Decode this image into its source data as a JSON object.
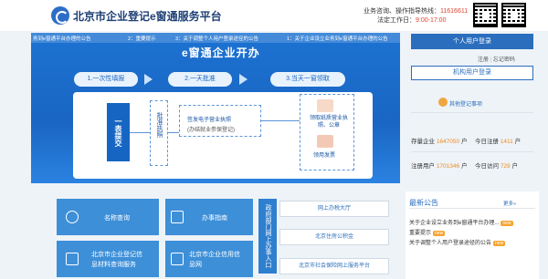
{
  "header": {
    "title": "北京市企业登记e窗通服务平台",
    "hotline_label": "业务咨询、操作指导热线：",
    "hotline_number": "11616611",
    "worktime_label": "法定工作日：",
    "worktime_value": "9:00-17:00"
  },
  "ticker": [
    "务到e窗通平台办理的公告",
    "2：重要提示",
    "3：关于调整个人用户登录途径的公告",
    "1：关于企业设立业务到e窗通平台办理的公告"
  ],
  "hero": {
    "title": "e窗通企业开办",
    "steps": [
      "1.一次性填报",
      "2.一天批准",
      "3.当天一窗领取"
    ],
    "left_label": "一表提交",
    "approve_label": "批准执照",
    "license_line1": "签发电子营业执照",
    "license_line2": "(办结就业参保登记)",
    "paper_label": "领取纸质营业执照、公章",
    "invoice_label": "领用发票"
  },
  "side": {
    "personal_login": "个人用户登录",
    "register": "注册",
    "forgot": "忘记密码",
    "org_login": "机构用户登录",
    "other_link": "其他登记事项",
    "stats": [
      {
        "label": "存量企业",
        "value": "1647050",
        "unit": "户"
      },
      {
        "label": "今日注册",
        "value": "1411",
        "unit": "户"
      },
      {
        "label": "注册用户",
        "value": "1701346",
        "unit": "户"
      },
      {
        "label": "今日访问",
        "value": "729",
        "unit": "户"
      }
    ]
  },
  "tiles": {
    "name_query": "名称查询",
    "guide": "办事指南",
    "info_service_1": "北京市企业登记信",
    "info_service_2": "息材料查询服务",
    "credit_1": "北京市企业信用信",
    "credit_2": "息网"
  },
  "services": {
    "side_label": "政府部门网上办事入口",
    "items": [
      "网上办税大厅",
      "北京住房公积金",
      "北京市社会保险网上服务平台"
    ]
  },
  "news": {
    "title": "最新公告",
    "more": "更多»",
    "items": [
      {
        "text": "关于企业设立业务到e窗通平台办理...",
        "badge": "new"
      },
      {
        "text": "重要提示",
        "badge": "new"
      },
      {
        "text": "关于调整个人用户登录途径的公告",
        "badge": "new"
      }
    ]
  }
}
